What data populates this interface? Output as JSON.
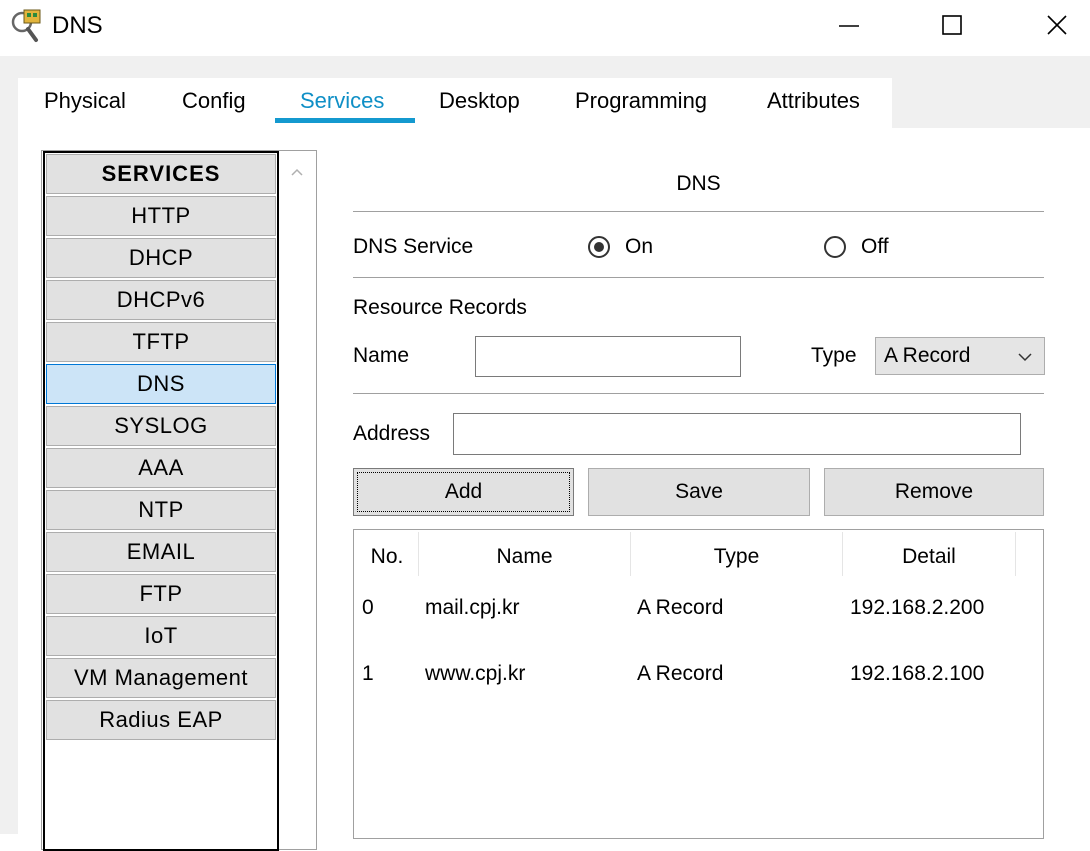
{
  "window": {
    "title": "DNS"
  },
  "tabs": [
    "Physical",
    "Config",
    "Services",
    "Desktop",
    "Programming",
    "Attributes"
  ],
  "active_tab": "Services",
  "sidebar": {
    "header": "SERVICES",
    "items": [
      "HTTP",
      "DHCP",
      "DHCPv6",
      "TFTP",
      "DNS",
      "SYSLOG",
      "AAA",
      "NTP",
      "EMAIL",
      "FTP",
      "IoT",
      "VM Management",
      "Radius EAP"
    ],
    "selected": "DNS"
  },
  "dns": {
    "heading": "DNS",
    "service_label": "DNS Service",
    "on_label": "On",
    "off_label": "Off",
    "service_state": "On",
    "resource_records_label": "Resource Records",
    "name_label": "Name",
    "name_value": "",
    "type_label": "Type",
    "type_value": "A Record",
    "address_label": "Address",
    "address_value": "",
    "add_label": "Add",
    "save_label": "Save",
    "remove_label": "Remove"
  },
  "table": {
    "columns": [
      "No.",
      "Name",
      "Type",
      "Detail"
    ],
    "rows": [
      [
        "0",
        "mail.cpj.kr",
        "A Record",
        "192.168.2.200"
      ],
      [
        "1",
        "www.cpj.kr",
        "A Record",
        "192.168.2.100"
      ]
    ]
  }
}
